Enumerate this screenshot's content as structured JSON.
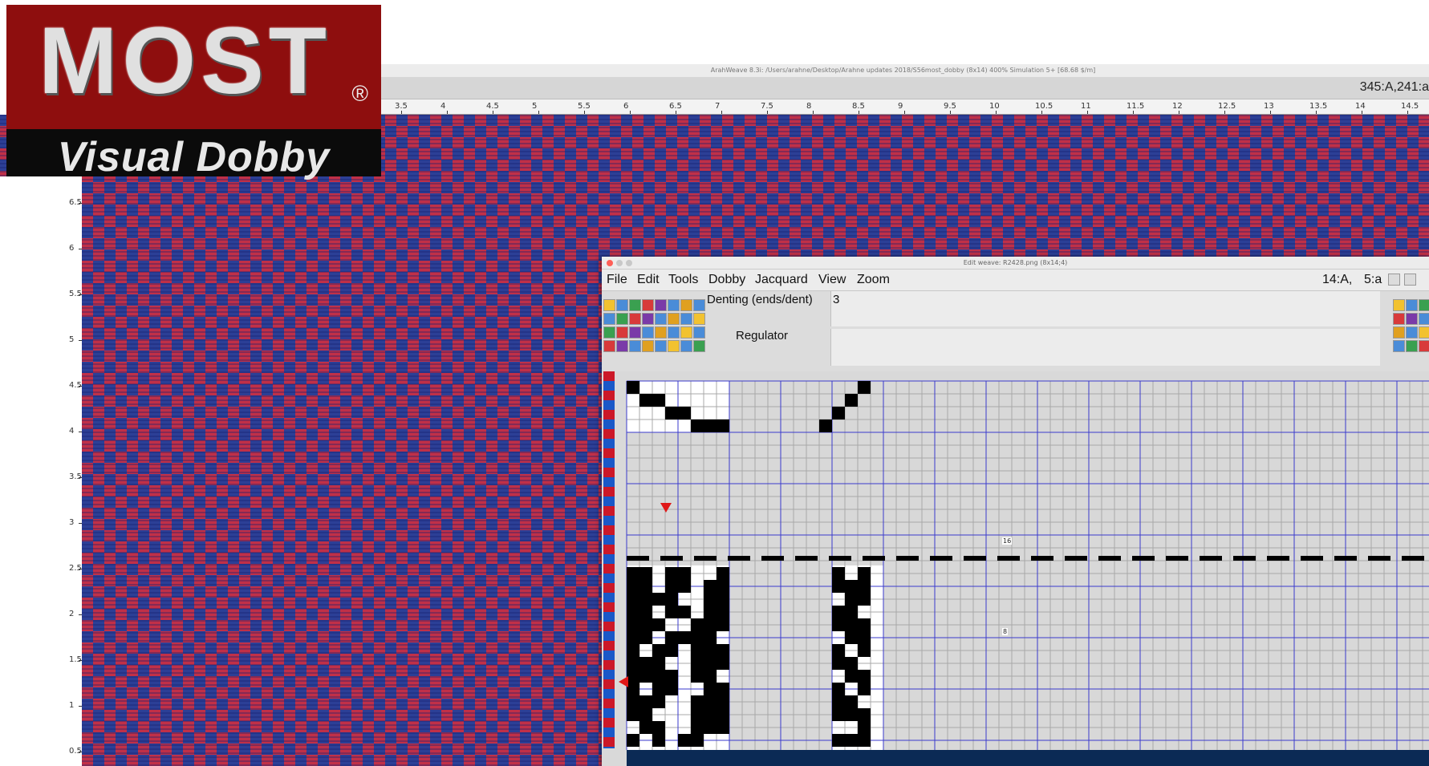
{
  "logo": {
    "word": "MOST",
    "registered": "®",
    "subtitle": "Visual  Dobby"
  },
  "main_window": {
    "title": "ArahWeave 8.3i: /Users/arahne/Desktop/Arahne updates 2018/S56most_dobby (8x14) 400% Simulation 5+ [68.68 $/m]",
    "status_coord": "345:A,241:a"
  },
  "h_ruler": [
    "3.5",
    "4",
    "4.5",
    "5",
    "5.5",
    "6",
    "6.5",
    "7",
    "7.5",
    "8",
    "8.5",
    "9",
    "9.5",
    "10",
    "10.5",
    "11",
    "11.5",
    "12",
    "12.5",
    "13",
    "13.5",
    "14",
    "14.5"
  ],
  "v_ruler": [
    "6.5",
    "6",
    "5.5",
    "5",
    "4.5",
    "4",
    "3.5",
    "3",
    "2.5",
    "2",
    "1.5",
    "1",
    "0.5"
  ],
  "edit_window": {
    "title": "Edit weave: R2428.png (8x14;4)",
    "menus": [
      "File",
      "Edit",
      "Tools",
      "Dobby",
      "Jacquard",
      "View",
      "Zoom"
    ],
    "status_a": "14:A,",
    "status_b": "5:a",
    "denting_label": "Denting (ends/dent)",
    "denting_value": "3",
    "regulator_label": "Regulator",
    "regulator_value": "",
    "marker_16": "16",
    "marker_8": "8"
  },
  "colors": {
    "red": "#cc1828",
    "blue": "#1a58c8",
    "grid_major": "#3a3acc",
    "fabric_red": "#c03048",
    "fabric_blue": "#2c3f96"
  }
}
